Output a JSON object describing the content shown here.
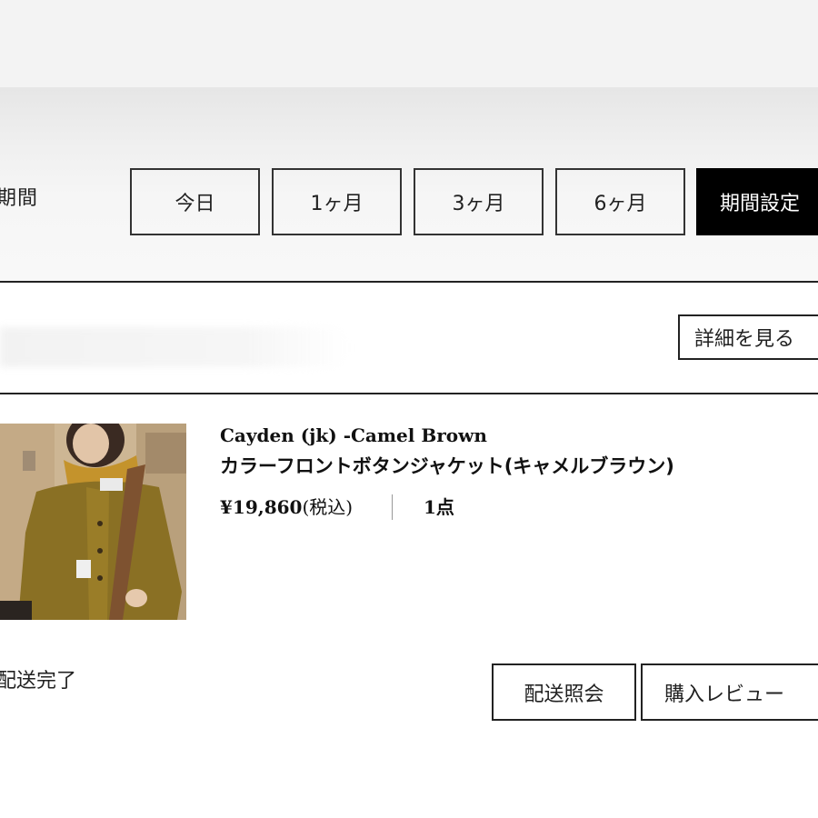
{
  "filter": {
    "label": "期間",
    "buttons": [
      {
        "label": "今日",
        "active": false
      },
      {
        "label": "1ヶ月",
        "active": false
      },
      {
        "label": "3ヶ月",
        "active": false
      },
      {
        "label": "6ヶ月",
        "active": false
      },
      {
        "label": "期間設定",
        "active": true
      }
    ]
  },
  "order": {
    "detail_label": "詳細を見る",
    "item": {
      "brand_name": "Cayden (jk) -Camel Brown",
      "product_name": "カラーフロントボタンジャケット(キャメルブラウン)",
      "price": "¥19,860",
      "tax_note": "(税込)",
      "quantity": "1点"
    },
    "status": "配送完了",
    "actions": {
      "track_label": "配送照会",
      "review_label": "購入レビュー"
    }
  },
  "colors": {
    "active_button_bg": "#000000",
    "border": "#222222",
    "header_band": "#f3f3f3"
  }
}
